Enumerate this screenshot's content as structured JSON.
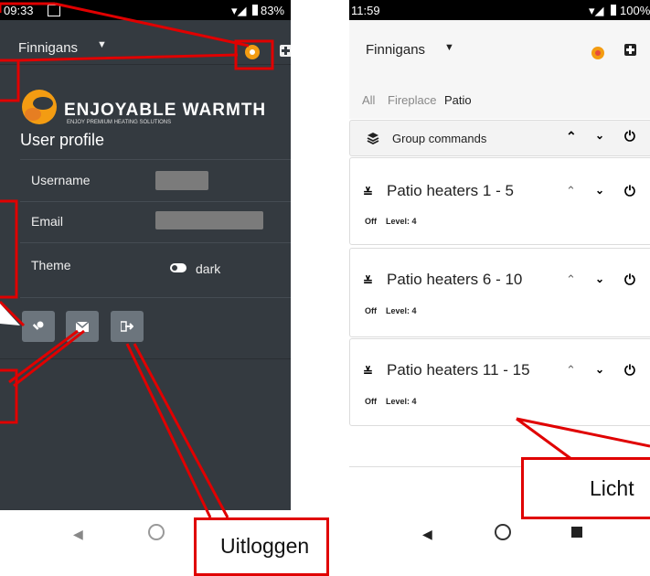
{
  "left_phone": {
    "status_time": "09:33",
    "battery": "83%",
    "location": "Finnigans",
    "logo_text": "ENJOYABLE WARMTH",
    "logo_tagline": "ENJOY PREMIUM HEATING SOLUTIONS",
    "page_title": "User profile",
    "fields": [
      {
        "label": "Username"
      },
      {
        "label": "Email"
      },
      {
        "label": "Theme",
        "value": "dark"
      }
    ],
    "icons": [
      "key-icon",
      "envelope-icon",
      "sign-out-icon"
    ]
  },
  "right_phone": {
    "status_time": "11:59",
    "battery": "100%",
    "location": "Finnigans",
    "tabs": [
      "All",
      "Fireplace",
      "Patio"
    ],
    "active_tab": "Patio",
    "group_commands": "Group commands",
    "groups": [
      {
        "name": "Patio heaters 1 - 5",
        "state": "Off",
        "level": "Level: 4"
      },
      {
        "name": "Patio heaters 6 - 10",
        "state": "Off",
        "level": "Level: 4"
      },
      {
        "name": "Patio heaters 11 - 15",
        "state": "Off",
        "level": "Level: 4"
      }
    ]
  },
  "callouts": {
    "logout": "Uitloggen",
    "light": "Licht"
  },
  "colors": {
    "highlight": "#e00000",
    "dark_bg": "#343a40",
    "button_grey": "#6c757d",
    "brand_orange": "#f39c12"
  }
}
